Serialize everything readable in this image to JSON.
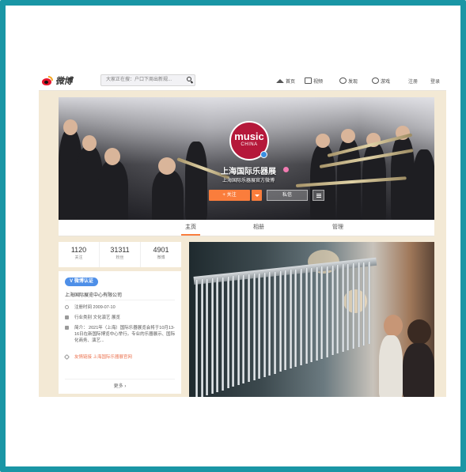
{
  "brand": {
    "logo_text": "微博"
  },
  "search": {
    "placeholder": "大家正在搜：户口下周出新规..."
  },
  "nav": {
    "home": "首页",
    "video": "视频",
    "discover": "发现",
    "game": "游戏",
    "register": "注册",
    "login": "登录"
  },
  "profile": {
    "avatar_line1": "music",
    "avatar_line2": "CHINA",
    "name": "上海国际乐器展",
    "description": "上海国际乐器展官方微博",
    "follow_label": "+ 关注",
    "message_label": "私信"
  },
  "tabs": [
    {
      "label": "主页",
      "active": true
    },
    {
      "label": "相册",
      "active": false
    },
    {
      "label": "管理",
      "active": false
    }
  ],
  "stats": [
    {
      "value": "1120",
      "label": "关注"
    },
    {
      "value": "31311",
      "label": "粉丝"
    },
    {
      "value": "4901",
      "label": "微博"
    }
  ],
  "info": {
    "badge": "V 微博认证",
    "company": "上海国际展览中心有限公司",
    "rows": [
      {
        "icon": "clock-icon",
        "text": "注册时间 2009-07-10"
      },
      {
        "icon": "industry-icon",
        "text": "行业类别 文化演艺 展览"
      },
      {
        "icon": "intro-icon",
        "text": "简介： 2021年（上海）国际乐器展览会将于10月13-16日在新国际博览中心举行。专业的乐器展示、国际化商务、演艺..."
      },
      {
        "icon": "tag-icon",
        "text": "友情链接 上海国际乐器展官网"
      }
    ],
    "more_label": "更多 ›"
  },
  "colors": {
    "frame_border": "#1a96a5",
    "page_bg": "#f3e9d5",
    "accent_orange": "#fa7d3c",
    "avatar_red": "#b5183a",
    "verify_blue": "#4e8fe8"
  }
}
